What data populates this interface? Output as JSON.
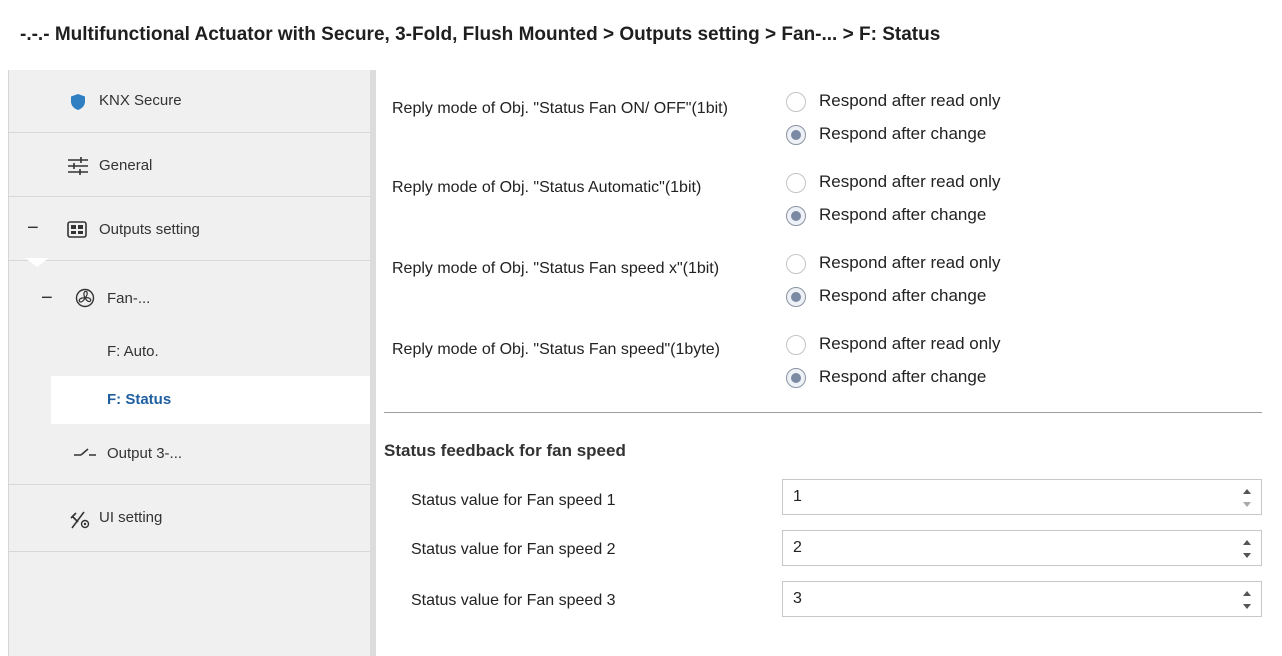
{
  "window": {
    "title": "-.-.- Multifunctional Actuator with Secure, 3-Fold, Flush Mounted > Outputs setting > Fan-... > F: Status"
  },
  "sidebar": {
    "items": [
      {
        "label": "KNX Secure",
        "icon": "shield-icon"
      },
      {
        "label": "General",
        "icon": "sliders-icon"
      },
      {
        "label": "Outputs setting",
        "icon": "outputs-grid-icon",
        "collapse": "−"
      },
      {
        "label": "Fan-...",
        "icon": "fan-icon",
        "collapse": "−"
      },
      {
        "label": "F: Auto."
      },
      {
        "label": "F: Status",
        "selected": true
      },
      {
        "label": "Output 3-...",
        "icon": "switch-icon"
      },
      {
        "label": "UI setting",
        "icon": "ui-setting-icon"
      }
    ]
  },
  "params": [
    {
      "label": "Reply mode of Obj. \"Status Fan ON/ OFF\"(1bit)",
      "options": [
        "Respond after read only",
        "Respond after change"
      ],
      "selected": 1
    },
    {
      "label": "Reply mode of Obj. \"Status Automatic\"(1bit)",
      "options": [
        "Respond after read only",
        "Respond after change"
      ],
      "selected": 1
    },
    {
      "label": "Reply mode of Obj. \"Status Fan speed x\"(1bit)",
      "options": [
        "Respond after read only",
        "Respond after change"
      ],
      "selected": 1
    },
    {
      "label": "Reply mode of Obj. \"Status Fan speed\"(1byte)",
      "options": [
        "Respond after read only",
        "Respond after change"
      ],
      "selected": 1
    }
  ],
  "section": {
    "title": "Status feedback for fan speed",
    "fields": [
      {
        "label": "Status value for Fan speed 1",
        "value": "1"
      },
      {
        "label": "Status value for Fan speed 2",
        "value": "2"
      },
      {
        "label": "Status value for Fan speed 3",
        "value": "3"
      }
    ]
  },
  "colors": {
    "accent": "#1f5fa0",
    "shield": "#2f7ec2",
    "sidebar_bg": "#f0f0f0",
    "radio_checked": "#7b8aa3"
  }
}
